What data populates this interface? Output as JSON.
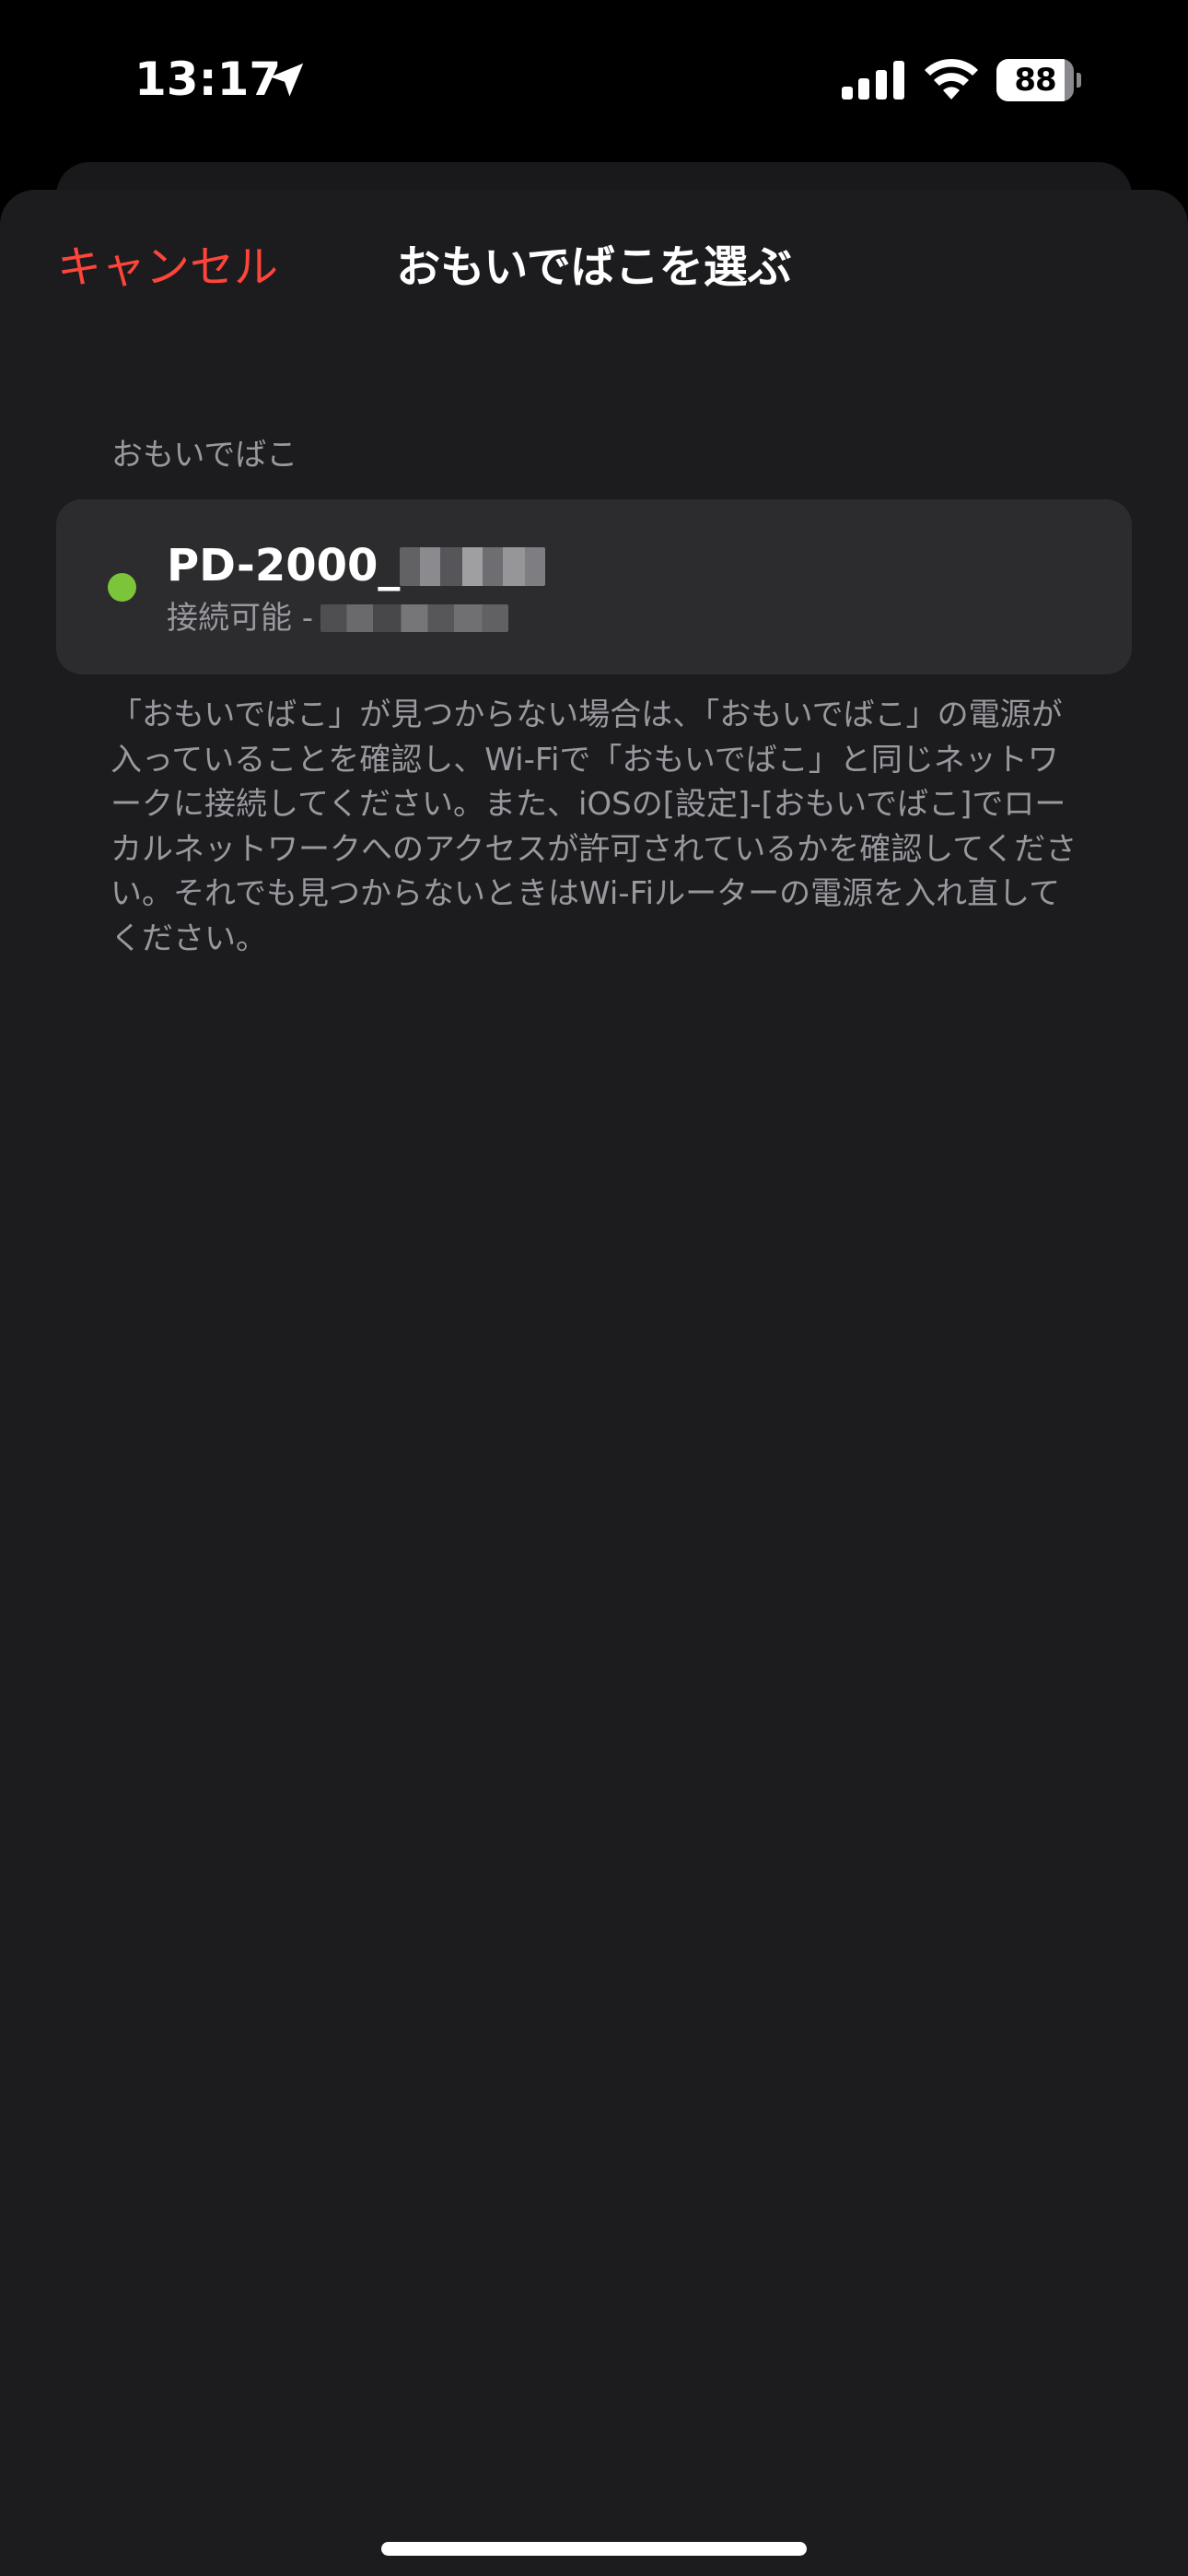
{
  "status_bar": {
    "time": "13:17",
    "battery_level": "88",
    "battery_fraction": 0.88
  },
  "nav": {
    "cancel_label": "キャンセル",
    "title": "おもいでばこを選ぶ"
  },
  "section": {
    "header": "おもいでばこ",
    "devices": [
      {
        "name": "PD-2000_",
        "status": "接続可能 - ",
        "status_color": "#7cc43a"
      }
    ],
    "footer": "「おもいでばこ」が見つからない場合は、「おもいでばこ」の電源が入っていることを確認し、Wi-Fiで「おもいでばこ」と同じネットワークに接続してください。また、iOSの[設定]-[おもいでばこ]でローカルネットワークへのアクセスが許可されているかを確認してください。それでも見つからないときはWi-Fiルーターの電源を入れ直してください。"
  },
  "colors": {
    "accent": "#ff453a",
    "background": "#1c1c1e",
    "cell": "#2c2c2e",
    "secondary_text": "#98989f"
  },
  "icons": {
    "location": "location-arrow-icon",
    "signal": "cellular-signal-icon",
    "wifi": "wifi-icon",
    "battery": "battery-icon"
  }
}
